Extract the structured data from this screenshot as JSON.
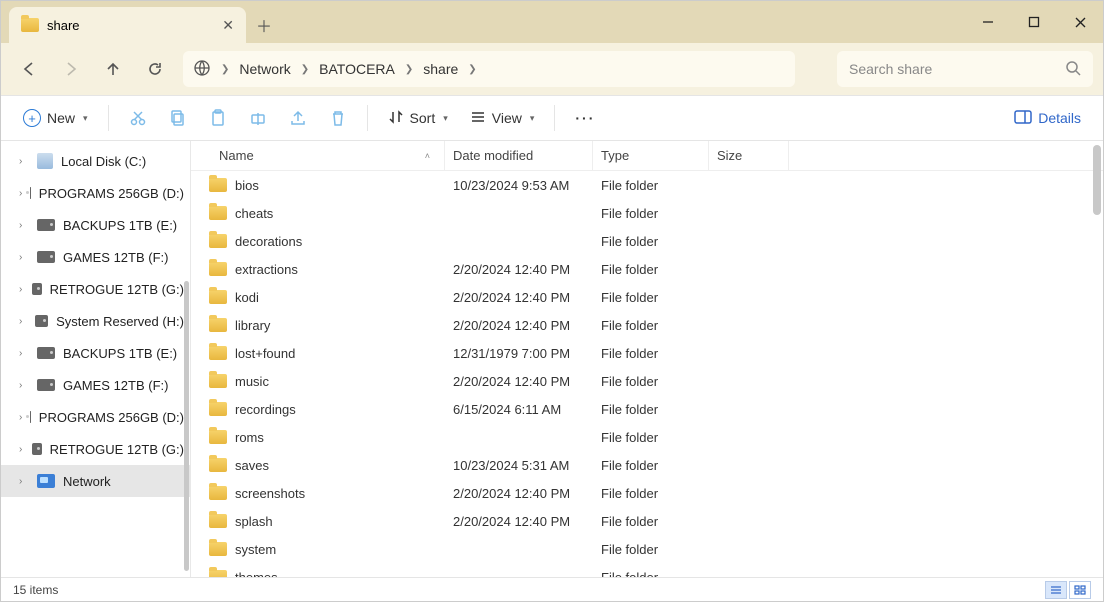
{
  "window": {
    "tab_title": "share"
  },
  "breadcrumb": {
    "seg0": "Network",
    "seg1": "BATOCERA",
    "seg2": "share"
  },
  "search": {
    "placeholder": "Search share"
  },
  "toolbar": {
    "new": "New",
    "sort": "Sort",
    "view": "View",
    "details": "Details"
  },
  "nav": {
    "items": [
      "Local Disk (C:)",
      "PROGRAMS 256GB (D:)",
      "BACKUPS 1TB (E:)",
      "GAMES 12TB (F:)",
      "RETROGUE 12TB (G:)",
      "System Reserved (H:)",
      "BACKUPS 1TB (E:)",
      "GAMES 12TB (F:)",
      "PROGRAMS 256GB (D:)",
      "RETROGUE 12TB (G:)",
      "Network"
    ]
  },
  "columns": {
    "name": "Name",
    "date": "Date modified",
    "type": "Type",
    "size": "Size"
  },
  "rows": [
    {
      "name": "bios",
      "date": "10/23/2024 9:53 AM",
      "type": "File folder",
      "size": ""
    },
    {
      "name": "cheats",
      "date": "",
      "type": "File folder",
      "size": ""
    },
    {
      "name": "decorations",
      "date": "",
      "type": "File folder",
      "size": ""
    },
    {
      "name": "extractions",
      "date": "2/20/2024 12:40 PM",
      "type": "File folder",
      "size": ""
    },
    {
      "name": "kodi",
      "date": "2/20/2024 12:40 PM",
      "type": "File folder",
      "size": ""
    },
    {
      "name": "library",
      "date": "2/20/2024 12:40 PM",
      "type": "File folder",
      "size": ""
    },
    {
      "name": "lost+found",
      "date": "12/31/1979 7:00 PM",
      "type": "File folder",
      "size": ""
    },
    {
      "name": "music",
      "date": "2/20/2024 12:40 PM",
      "type": "File folder",
      "size": ""
    },
    {
      "name": "recordings",
      "date": "6/15/2024 6:11 AM",
      "type": "File folder",
      "size": ""
    },
    {
      "name": "roms",
      "date": "",
      "type": "File folder",
      "size": ""
    },
    {
      "name": "saves",
      "date": "10/23/2024 5:31 AM",
      "type": "File folder",
      "size": ""
    },
    {
      "name": "screenshots",
      "date": "2/20/2024 12:40 PM",
      "type": "File folder",
      "size": ""
    },
    {
      "name": "splash",
      "date": "2/20/2024 12:40 PM",
      "type": "File folder",
      "size": ""
    },
    {
      "name": "system",
      "date": "",
      "type": "File folder",
      "size": ""
    },
    {
      "name": "themes",
      "date": "",
      "type": "File folder",
      "size": ""
    }
  ],
  "status": {
    "count": "15 items"
  }
}
